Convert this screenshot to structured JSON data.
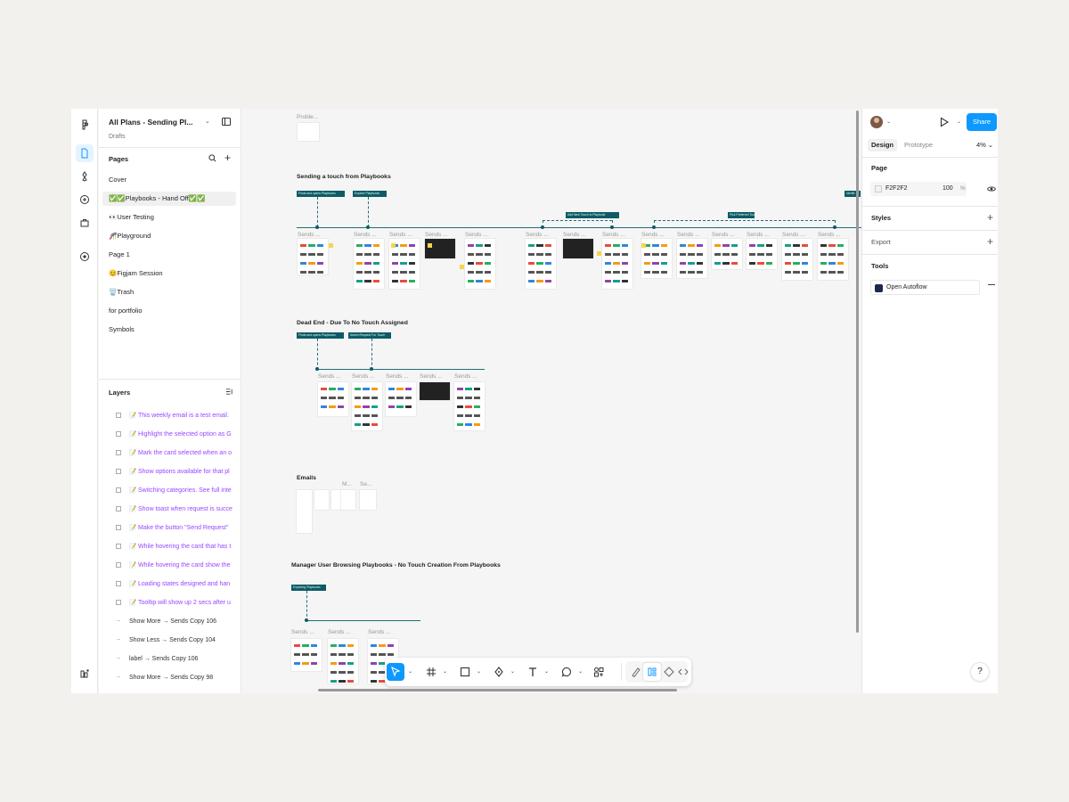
{
  "file": {
    "title": "All Plans - Sending Pl...",
    "subtitle": "Drafts"
  },
  "pages": {
    "title": "Pages",
    "items": [
      "Cover",
      "✅✅Playbooks - Hand Off✅✅",
      "👀User Testing",
      "🎢Playground",
      "Page 1",
      "😊Figjam Session",
      "🗑️Trash",
      "for portfolio",
      "Symbols"
    ],
    "selected_index": 1
  },
  "layers": {
    "title": "Layers",
    "items": [
      {
        "text": "This weekly email is a test email.",
        "kind": "comment"
      },
      {
        "text": "Highlight the selected option as G",
        "kind": "comment"
      },
      {
        "text": "Mark the card selected when an o",
        "kind": "comment"
      },
      {
        "text": "Show options available for that pl",
        "kind": "comment"
      },
      {
        "text": "Switching categories. See full inte",
        "kind": "comment"
      },
      {
        "text": "Show toast when request is succe",
        "kind": "comment"
      },
      {
        "text": "Make the button \"Send Request\"",
        "kind": "comment"
      },
      {
        "text": "While hovering the card that has t",
        "kind": "comment"
      },
      {
        "text": "While hovering the card show the",
        "kind": "comment"
      },
      {
        "text": "Loading states designed and han",
        "kind": "comment"
      },
      {
        "text": "Tooltip will show up 2 secs after u",
        "kind": "comment"
      },
      {
        "text": "Show More → Sends Copy 106",
        "kind": "connector"
      },
      {
        "text": "Show Less → Sends Copy 104",
        "kind": "connector"
      },
      {
        "text": "label → Sends Copy 106",
        "kind": "connector"
      },
      {
        "text": "Show More → Sends Copy 98",
        "kind": "connector"
      }
    ]
  },
  "canvas": {
    "top_label": "Proble...",
    "sections": [
      {
        "heading": "Sending a touch from Playbooks",
        "tags": [
          "Finds and opens Playbooks",
          "Explore Playbooks"
        ],
        "right_tag": "Identif...",
        "flow_tags": [
          "Add New Touch to Playbook",
          "Pick Preferred Touch"
        ]
      },
      {
        "heading": "Dead End - Due To No Touch Assigned",
        "tags": [
          "Finds and opens Playbooks",
          "Admin Request For Touch"
        ]
      },
      {
        "heading": "Emails"
      },
      {
        "heading": "Manager User Browsing Playbooks - No Touch Creation From Playbooks",
        "tags": [
          "Exploring Playbooks"
        ]
      }
    ],
    "frame_label": "Sends ...",
    "email_labels": [
      "M...",
      "Se..."
    ]
  },
  "toolbar": {
    "tools": [
      "move-tool",
      "frame-tool",
      "shape-tool",
      "pen-tool",
      "text-tool",
      "comment-tool",
      "actions-tool"
    ],
    "right_modes": [
      "draw-mode",
      "design-mode",
      "prototype-mode",
      "dev-mode"
    ]
  },
  "right": {
    "share": "Share",
    "tabs": [
      "Design",
      "Prototype"
    ],
    "zoom": "4%",
    "page_section": "Page",
    "page_color": "F2F2F2",
    "page_opacity": "100",
    "page_opacity_unit": "%",
    "styles": "Styles",
    "export": "Export",
    "tools": "Tools",
    "tool_item": "Open Autoflow",
    "help": "?"
  },
  "colors": {
    "accent": "#0d99ff",
    "flow_teal": "#0f5a66",
    "comment_purple": "#9747ff"
  }
}
